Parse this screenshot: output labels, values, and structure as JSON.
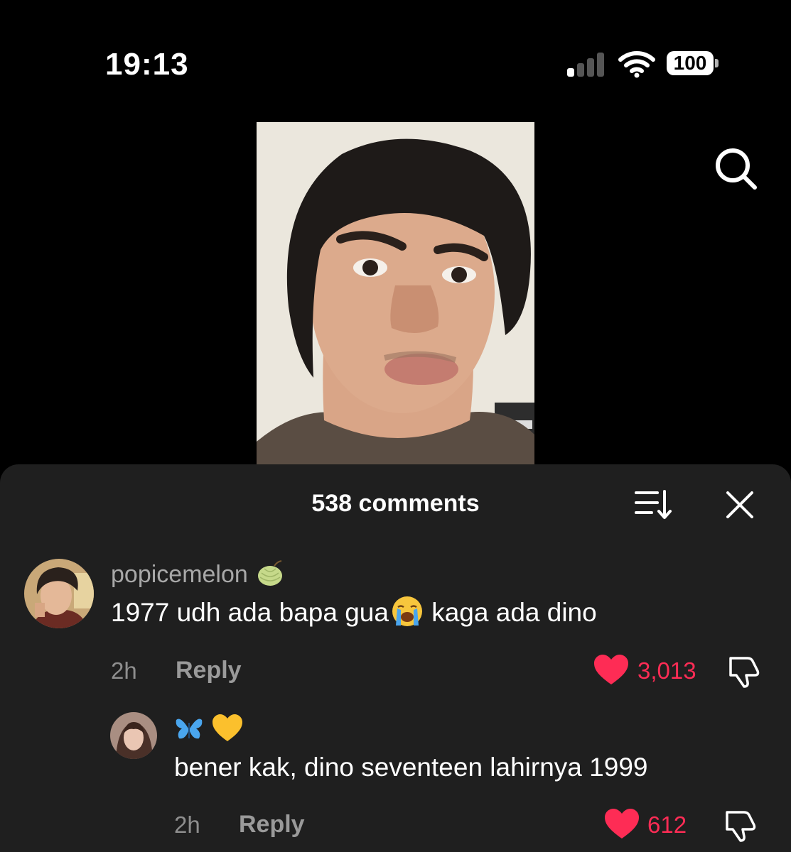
{
  "status": {
    "time": "19:13",
    "battery": "100"
  },
  "header": {
    "comment_count": "538 comments"
  },
  "comments": [
    {
      "username": "popicemelon",
      "text_before": "1977 udh ada bapa gua",
      "text_after": " kaga ada dino",
      "time": "2h",
      "reply_label": "Reply",
      "likes": "3,013"
    },
    {
      "username_emojis": "butterfly-yellow-heart",
      "text": "bener kak, dino seventeen lahirnya 1999",
      "time": "2h",
      "reply_label": "Reply",
      "likes": "612"
    }
  ],
  "colors": {
    "accent": "#fe2c55",
    "sheet": "#1f1f1f",
    "background": "#000000"
  }
}
